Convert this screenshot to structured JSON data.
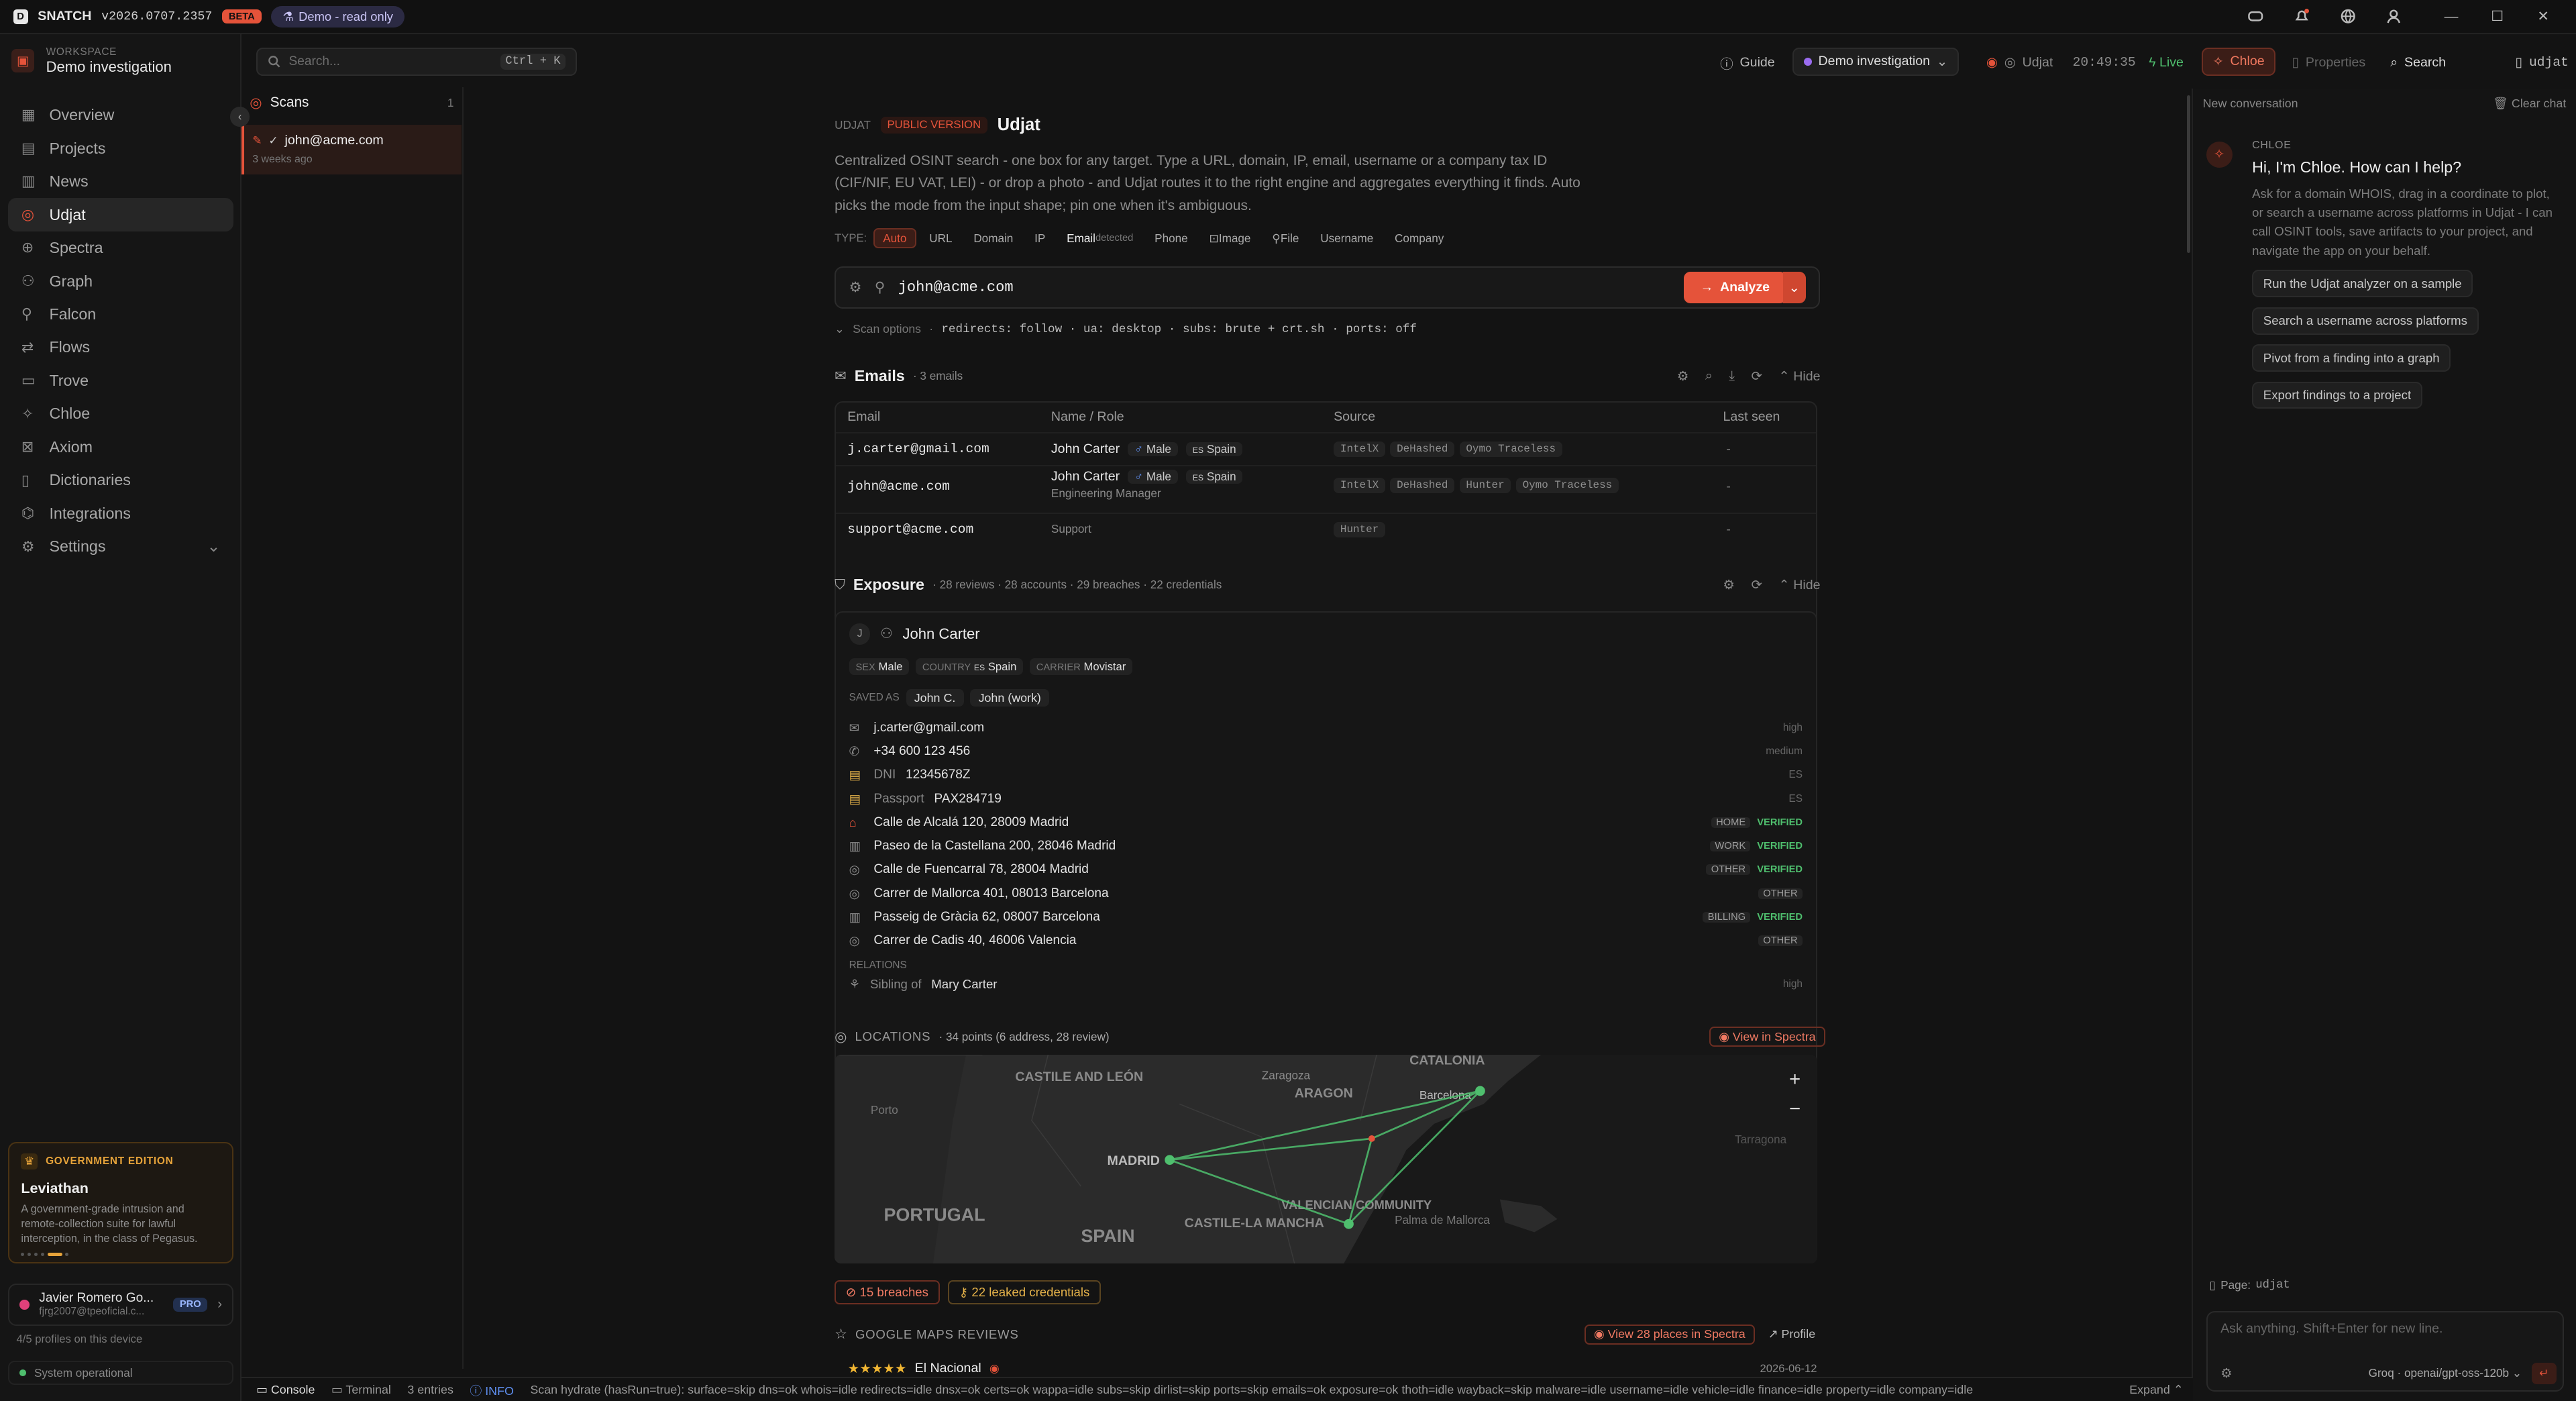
{
  "app": {
    "name": "SNATCH",
    "version": "v2026.0707.2357",
    "beta": "BETA",
    "demo": "Demo - read only"
  },
  "sidebar": {
    "workspace_label": "WORKSPACE",
    "workspace": "Demo investigation",
    "items": [
      {
        "label": "Overview",
        "icon": "grid-icon"
      },
      {
        "label": "Projects",
        "icon": "folder-icon"
      },
      {
        "label": "News",
        "icon": "news-icon"
      },
      {
        "label": "Udjat",
        "icon": "target-icon"
      },
      {
        "label": "Spectra",
        "icon": "globe-icon"
      },
      {
        "label": "Graph",
        "icon": "graph-icon"
      },
      {
        "label": "Falcon",
        "icon": "falcon-icon"
      },
      {
        "label": "Flows",
        "icon": "flows-icon"
      },
      {
        "label": "Trove",
        "icon": "trove-icon"
      },
      {
        "label": "Chloe",
        "icon": "sparkle-icon"
      },
      {
        "label": "Axiom",
        "icon": "axiom-icon"
      },
      {
        "label": "Dictionaries",
        "icon": "book-icon"
      },
      {
        "label": "Integrations",
        "icon": "plug-icon"
      },
      {
        "label": "Settings",
        "icon": "gear-icon"
      }
    ],
    "promo": {
      "edition": "GOVERNMENT EDITION",
      "title": "Leviathan",
      "text": "A government-grade intrusion and remote-collection suite for lawful interception, in the class of Pegasus."
    },
    "user": {
      "name": "Javier Romero Go...",
      "email": "fjrg2007@tpeoficial.c...",
      "plan": "PRO"
    },
    "profiles": "4/5 profiles on this device",
    "status": "System operational"
  },
  "scans": {
    "title": "Scans",
    "count": "1",
    "item": "john@acme.com",
    "time": "3 weeks ago"
  },
  "topbar": {
    "search_placeholder": "Search...",
    "shortcut": "Ctrl + K",
    "guide": "Guide",
    "investigation": "Demo investigation",
    "module": "Udjat",
    "clock": "20:49:35",
    "live": "Live",
    "chloe": "Chloe",
    "properties": "Properties",
    "search": "Search",
    "page": "udjat"
  },
  "udjat": {
    "crumb": "UDJAT",
    "public": "PUBLIC VERSION",
    "title": "Udjat",
    "description": "Centralized OSINT search - one box for any target. Type a URL, domain, IP, email, username or a company tax ID (CIF/NIF, EU VAT, LEI) - or drop a photo - and Udjat routes it to the right engine and aggregates everything it finds. Auto picks the mode from the input shape; pin one when it's ambiguous.",
    "type_label": "TYPE:",
    "types": [
      "Auto",
      "URL",
      "Domain",
      "IP",
      "Email",
      "Phone",
      "Image",
      "File",
      "Username",
      "Company"
    ],
    "detected": "detected",
    "query": "john@acme.com",
    "analyze": "Analyze",
    "scan_options_label": "Scan options",
    "scan_options": "redirects: follow · ua: desktop · subs: brute + crt.sh · ports: off"
  },
  "emails": {
    "title": "Emails",
    "count": "· 3 emails",
    "hide": "Hide",
    "headers": [
      "Email",
      "Name / Role",
      "Source",
      "Last seen"
    ],
    "rows": [
      {
        "email": "j.carter@gmail.com",
        "name": "John Carter",
        "sex": "Male",
        "country": "Spain",
        "role": "",
        "sources": [
          "IntelX",
          "DeHashed",
          "Oymo Traceless"
        ],
        "seen": "-"
      },
      {
        "email": "john@acme.com",
        "name": "John Carter",
        "sex": "Male",
        "country": "Spain",
        "role": "Engineering Manager",
        "sources": [
          "IntelX",
          "DeHashed",
          "Hunter",
          "Oymo Traceless"
        ],
        "seen": "-"
      },
      {
        "email": "support@acme.com",
        "name": "",
        "sex": "",
        "country": "",
        "role": "Support",
        "sources": [
          "Hunter"
        ],
        "seen": "-"
      }
    ]
  },
  "exposure": {
    "title": "Exposure",
    "summary": "· 28 reviews · 28 accounts · 29 breaches · 22 credentials",
    "hide": "Hide",
    "initial": "J",
    "name": "John Carter",
    "attrs": [
      {
        "k": "SEX",
        "v": "Male"
      },
      {
        "k": "COUNTRY",
        "v": "Spain"
      },
      {
        "k": "CARRIER",
        "v": "Movistar"
      }
    ],
    "saved_label": "SAVED AS",
    "saved": [
      "John C.",
      "John (work)"
    ],
    "items": [
      {
        "icon": "mail-icon",
        "label": "",
        "value": "j.carter@gmail.com",
        "loc": "",
        "ver": "",
        "conf": "high"
      },
      {
        "icon": "phone-icon",
        "label": "",
        "value": "+34 600 123 456",
        "loc": "",
        "ver": "",
        "conf": "medium"
      },
      {
        "icon": "id-icon",
        "label": "DNI",
        "value": "12345678Z",
        "loc": "",
        "ver": "",
        "conf": "ES"
      },
      {
        "icon": "passport-icon",
        "label": "Passport",
        "value": "PAX284719",
        "loc": "",
        "ver": "",
        "conf": "ES"
      },
      {
        "icon": "home-icon",
        "label": "",
        "value": "Calle de Alcalá 120, 28009 Madrid",
        "loc": "HOME",
        "ver": "VERIFIED",
        "conf": ""
      },
      {
        "icon": "building-icon",
        "label": "",
        "value": "Paseo de la Castellana 200, 28046 Madrid",
        "loc": "WORK",
        "ver": "VERIFIED",
        "conf": ""
      },
      {
        "icon": "pin-icon",
        "label": "",
        "value": "Calle de Fuencarral 78, 28004 Madrid",
        "loc": "OTHER",
        "ver": "VERIFIED",
        "conf": ""
      },
      {
        "icon": "pin-icon",
        "label": "",
        "value": "Carrer de Mallorca 401, 08013 Barcelona",
        "loc": "OTHER",
        "ver": "",
        "conf": ""
      },
      {
        "icon": "building-icon",
        "label": "",
        "value": "Passeig de Gràcia 62, 08007 Barcelona",
        "loc": "BILLING",
        "ver": "VERIFIED",
        "conf": ""
      },
      {
        "icon": "pin-icon",
        "label": "",
        "value": "Carrer de Cadis 40, 46006 Valencia",
        "loc": "OTHER",
        "ver": "",
        "conf": ""
      }
    ],
    "relations_label": "RELATIONS",
    "relation_type": "Sibling of",
    "relation": "Mary Carter",
    "relation_conf": "high"
  },
  "locations": {
    "title": "LOCATIONS",
    "summary": "· 34 points (6 address, 28 review)",
    "view": "View in Spectra",
    "map_labels": [
      "CATALONIA",
      "CASTILE AND LEÓN",
      "Zaragoza",
      "ARAGON",
      "Barcelona",
      "Porto",
      "MADRID",
      "PORTUGAL",
      "SPAIN",
      "CASTILE-LA MANCHA",
      "VALENCIAN COMMUNITY",
      "Palma de Mallorca",
      "Tarragona"
    ]
  },
  "breaches": {
    "breaches": "15 breaches",
    "creds": "22 leaked credentials"
  },
  "reviews": {
    "title": "GOOGLE MAPS REVIEWS",
    "view": "View 28 places in Spectra",
    "profile": "Profile",
    "stars": "★★★★★",
    "place": "El Nacional",
    "date": "2026-06-12"
  },
  "chloe": {
    "new_conv": "New conversation",
    "clear": "Clear chat",
    "label": "CHLOE",
    "greeting": "Hi, I'm Chloe. How can I help?",
    "intro": "Ask for a domain WHOIS, drag in a coordinate to plot, or search a username across platforms in Udjat - I can call OSINT tools, save artifacts to your project, and navigate the app on your behalf.",
    "suggestions": [
      "Run the Udjat analyzer on a sample",
      "Search a username across platforms",
      "Pivot from a finding into a graph",
      "Export findings to a project"
    ],
    "page_label": "Page:",
    "page": "udjat",
    "placeholder": "Ask anything. Shift+Enter for new line.",
    "model": "Groq · openai/gpt-oss-120b"
  },
  "console": {
    "console": "Console",
    "terminal": "Terminal",
    "entries": "3 entries",
    "level": "INFO",
    "message": "Scan hydrate (hasRun=true): surface=skip dns=ok whois=idle redirects=idle dnsx=ok certs=ok wappa=idle subs=skip dirlist=skip ports=skip emails=ok exposure=ok thoth=idle wayback=skip malware=idle username=idle vehicle=idle finance=idle property=idle company=idle",
    "expand": "Expand"
  }
}
